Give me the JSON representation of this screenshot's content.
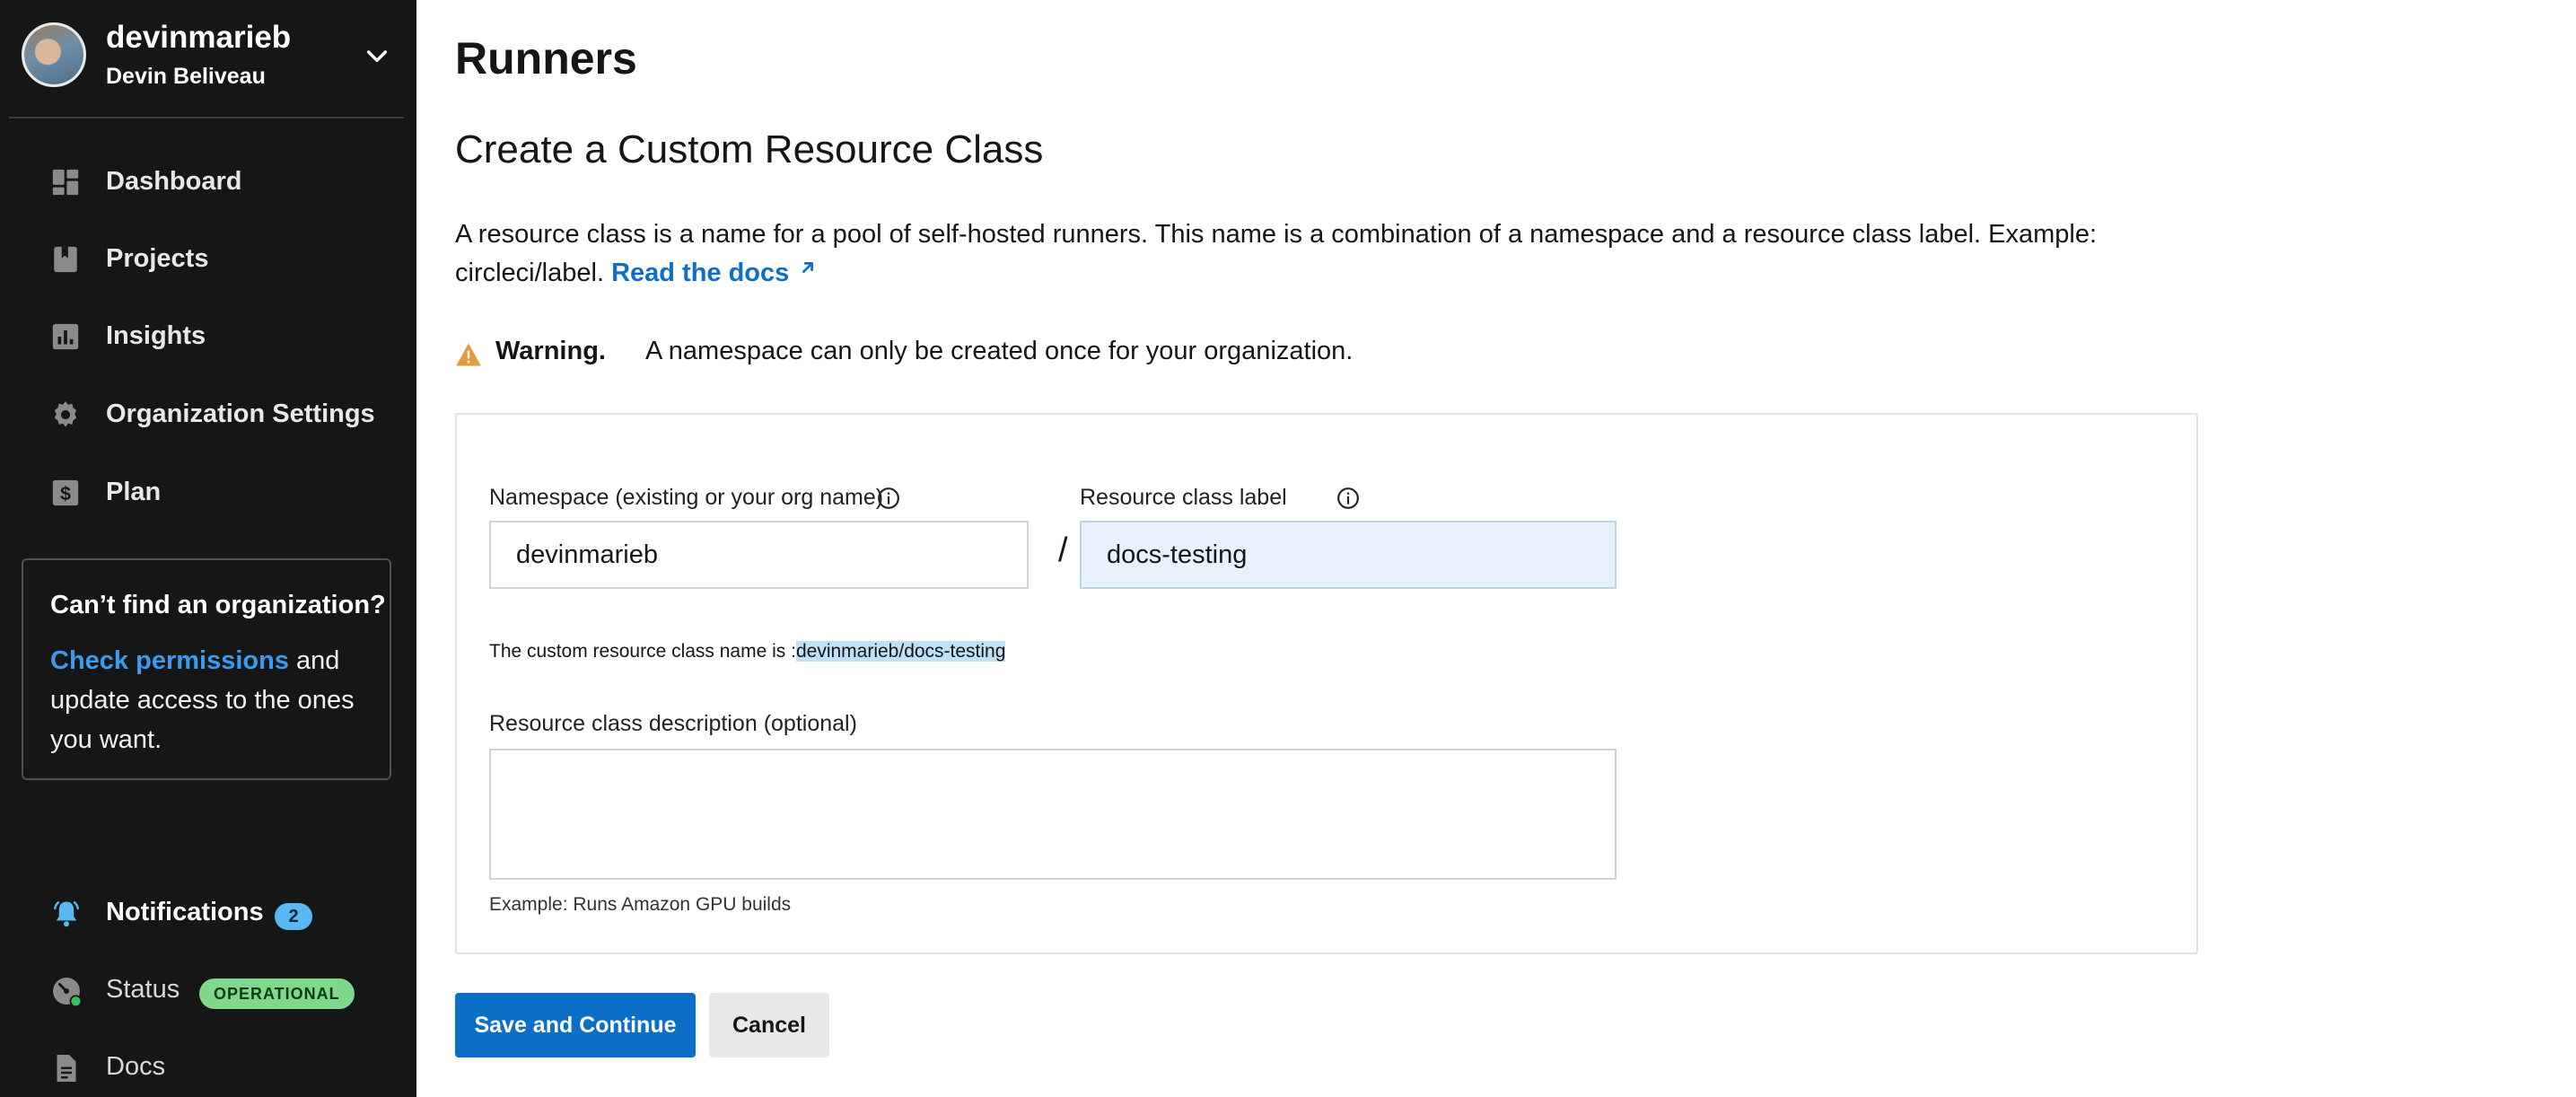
{
  "sidebar": {
    "org_name": "devinmarieb",
    "user_name": "Devin Beliveau",
    "nav": [
      {
        "label": "Dashboard",
        "icon": "dashboard-icon"
      },
      {
        "label": "Projects",
        "icon": "projects-icon"
      },
      {
        "label": "Insights",
        "icon": "insights-icon"
      },
      {
        "label": "Organization Settings",
        "icon": "gear-icon"
      },
      {
        "label": "Plan",
        "icon": "dollar-icon"
      }
    ],
    "help": {
      "title": "Can’t find an organization?",
      "link": "Check permissions",
      "text": " and update access to the ones you want."
    },
    "bottom": {
      "notifications": {
        "label": "Notifications",
        "count": "2"
      },
      "status": {
        "label": "Status",
        "badge": "OPERATIONAL"
      },
      "docs": {
        "label": "Docs"
      }
    }
  },
  "main": {
    "title": "Runners",
    "section_title": "Create a Custom Resource Class",
    "description": "A resource class is a name for a pool of self-hosted runners. This name is a combination of a namespace and a resource class label. Example: circleci/label. ",
    "docs_link": "Read the docs",
    "warning_bold": "Warning.",
    "warning_text": "A namespace can only be created once for your organization.",
    "form": {
      "namespace_label": "Namespace (existing or your org name)",
      "namespace_value": "devinmarieb",
      "slash": "/",
      "label_label": "Resource class label",
      "label_value": "docs-testing",
      "resolved_prefix": "The custom resource class name is :",
      "resolved_value": "devinmarieb/docs-testing",
      "description_label": "Resource class description (optional)",
      "description_value": "",
      "example": "Example: Runs Amazon GPU builds"
    },
    "buttons": {
      "save": "Save and Continue",
      "cancel": "Cancel"
    }
  },
  "colors": {
    "sidebar_bg": "#161616",
    "primary": "#0b6fc8",
    "link": "#0e6ec8",
    "warning": "#e39a3b",
    "badge_notifications": "#5ab8f0",
    "badge_operational": "#7fd88c"
  }
}
